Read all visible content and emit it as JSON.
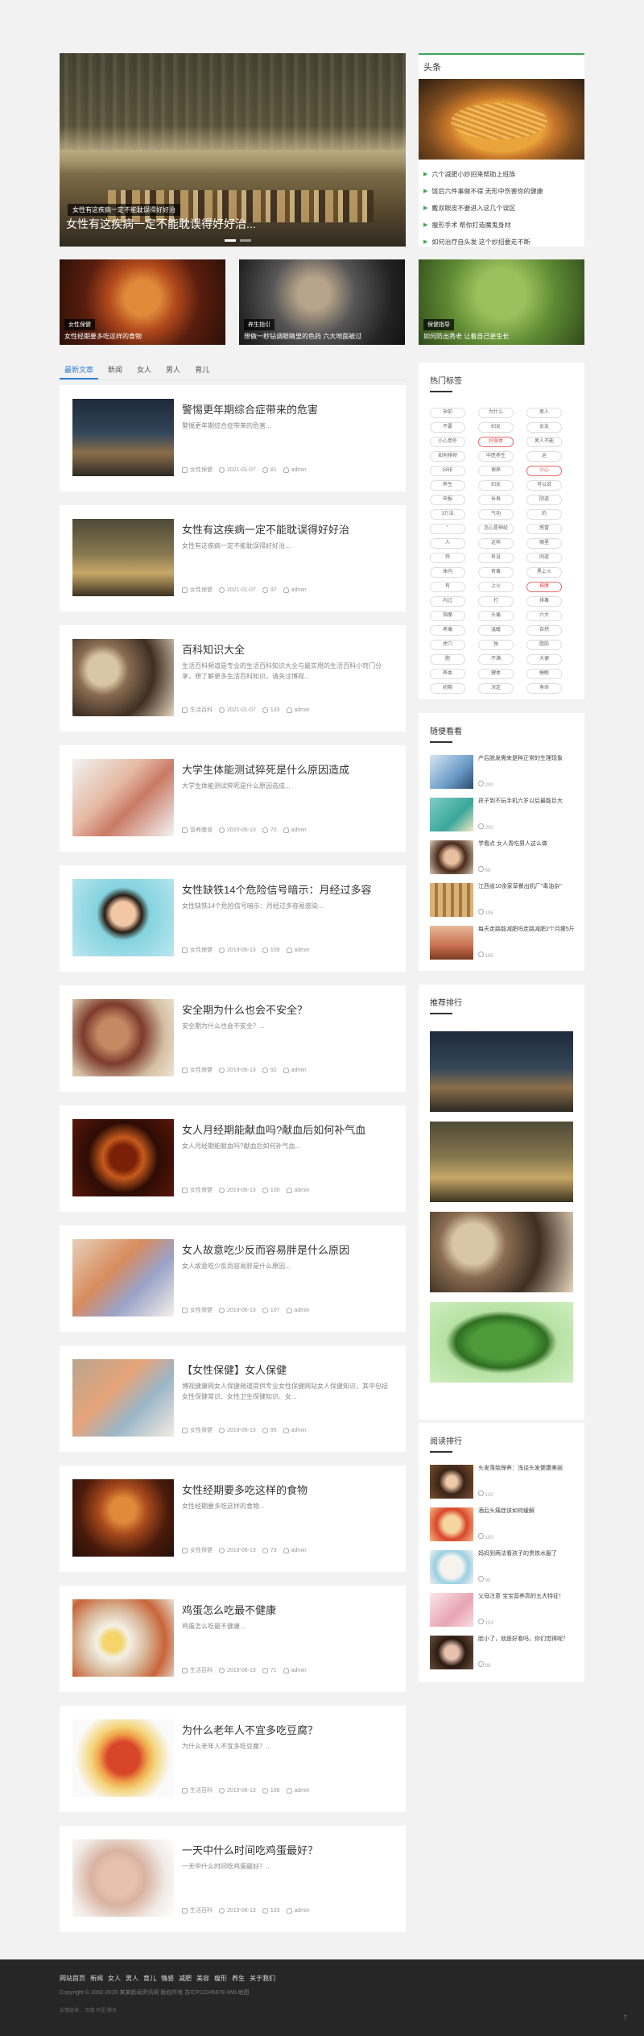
{
  "hero": {
    "tag": "女性有这疾病一定不能耽误得好好治",
    "caption": "女性有这疾病一定不能耽误得好好治..."
  },
  "headline": {
    "title": "头条",
    "items": [
      "六个减肥小妙招来帮助上班族",
      "饭后六件事做不得 无形中伤害你的健康",
      "戴双眼皮不要进入这几个误区",
      "瘦形手术 帮你打造魔鬼身材",
      "如何治疗自头发 这个妙招要走不断"
    ]
  },
  "small_cards": [
    {
      "tag": "女性保健",
      "caption": "女性经期要多吃这样的食物"
    },
    {
      "tag": "养生指引",
      "caption": "想做一秒钻调眼睛里的色药 六大地面被过"
    },
    {
      "tag": "保健指导",
      "caption": "如何防出秀老 让着自己更生长"
    }
  ],
  "tabs": [
    "最新文章",
    "新闻",
    "女人",
    "男人",
    "育儿"
  ],
  "articles": [
    {
      "title": "警惕更年期综合症带来的危害",
      "desc": "警惕更年期综合症带来的危害...",
      "cat": "女性保健",
      "date": "2021-01-07",
      "views": "81",
      "author": "admin"
    },
    {
      "title": "女性有这疾病一定不能耽误得好好治",
      "desc": "女性有这疾病一定不能耽误得好好治...",
      "cat": "女性保健",
      "date": "2021-01-07",
      "views": "97",
      "author": "admin"
    },
    {
      "title": "百科知识大全",
      "desc": "生活百科频道是专业的生活百科知识大全与最实用的生活百科小窍门分享，想了解更多生活百科知识，请关注博视...",
      "cat": "生活百科",
      "date": "2021-01-07",
      "views": "133",
      "author": "admin"
    },
    {
      "title": "大学生体能测试猝死是什么原因造成",
      "desc": "大学生体能测试猝死是什么原因造成...",
      "cat": "营养膳食",
      "date": "2020-06-10",
      "views": "70",
      "author": "admin"
    },
    {
      "title": "女性缺铁14个危险信号暗示：月经过多容",
      "desc": "女性缺铁14个危险信号暗示：月经过多容易感染...",
      "cat": "女性保健",
      "date": "2019-06-13",
      "views": "109",
      "author": "admin"
    },
    {
      "title": "安全期为什么也会不安全？",
      "desc": "安全期为什么也会不安全？...",
      "cat": "女性保健",
      "date": "2019-06-13",
      "views": "92",
      "author": "admin"
    },
    {
      "title": "女人月经期能献血吗?献血后如何补气血",
      "desc": "女人月经期能献血吗?献血后如何补气血...",
      "cat": "女性保健",
      "date": "2019-06-13",
      "views": "100",
      "author": "admin"
    },
    {
      "title": "女人故意吃少反而容易胖是什么原因",
      "desc": "女人故意吃少反而容易胖是什么原因...",
      "cat": "女性保健",
      "date": "2019-06-13",
      "views": "107",
      "author": "admin"
    },
    {
      "title": "【女性保健】女人保健",
      "desc": "博视健康网女人保健频道提供专业女性保健网站女人保健知识，其中包括女性保健常识、女性卫生保健知识、女...",
      "cat": "女性保健",
      "date": "2019-06-13",
      "views": "95",
      "author": "admin"
    },
    {
      "title": "女性经期要多吃这样的食物",
      "desc": "女性经期要多吃这样的食物...",
      "cat": "女性保健",
      "date": "2019-06-13",
      "views": "73",
      "author": "admin"
    },
    {
      "title": "鸡蛋怎么吃最不健康",
      "desc": "鸡蛋怎么吃最不健康...",
      "cat": "生活百科",
      "date": "2019-06-13",
      "views": "71",
      "author": "admin"
    },
    {
      "title": "为什么老年人不宜多吃豆腐？",
      "desc": "为什么老年人不宜多吃豆腐？...",
      "cat": "生活百科",
      "date": "2019-06-13",
      "views": "106",
      "author": "admin"
    },
    {
      "title": "一天中什么时间吃鸡蛋最好？",
      "desc": "一天中什么时间吃鸡蛋最好？...",
      "cat": "生活百科",
      "date": "2019-06-13",
      "views": "103",
      "author": "admin"
    }
  ],
  "hot_tags": {
    "title": "热门标签",
    "items": [
      "孕前",
      "为什么",
      "男人",
      "不要",
      "妇女",
      "女友",
      "小心意外",
      "好身体",
      "男人不能",
      "如何排卵",
      "中医养生",
      "运",
      "GRE",
      "保养",
      "小心",
      "养生",
      "妇女",
      "可以说",
      "申报",
      "长寿",
      "阴道",
      "3方法",
      "气功",
      "的",
      "\"",
      "怎心是神经",
      "感冒",
      "人",
      "这样",
      "哪里",
      "鸡",
      "有没",
      "同道",
      "体内",
      "有毒",
      "黑上火",
      "有",
      "上火",
      "按摩",
      "内过",
      "打",
      "排毒",
      "指摩",
      "头痛",
      "六大",
      "疼痛",
      "温暖",
      "自然",
      "虎穴",
      "独",
      "脂肪",
      "胞",
      "不满",
      "大便",
      "养血",
      "健体",
      "睡眠",
      "初期",
      "决定",
      "寿命"
    ]
  },
  "random": {
    "title": "随便看看",
    "items": [
      {
        "title": "产后脱发需来是种正常的生理现象",
        "views": "200"
      },
      {
        "title": "孩子到不玩手机六岁以后最能巨大",
        "views": "200"
      },
      {
        "title": "学看点 女人青吃男人这么做",
        "views": "68"
      },
      {
        "title": "江西省10余家草餐出机厂\"毒油杂\"",
        "views": "195"
      },
      {
        "title": "每天走路能减肥吗走路减肥2个月瘦5斤",
        "views": "195"
      }
    ]
  },
  "recommend": {
    "title": "推荐排行"
  },
  "reading": {
    "title": "阅读排行",
    "items": [
      {
        "title": "头发落始保养：浅谈头发健康美丽",
        "views": "132"
      },
      {
        "title": "酒后头痛症该如何缓解",
        "views": "193"
      },
      {
        "title": "妈妈到两法看孩子的贵铁水服了",
        "views": "90"
      },
      {
        "title": "父母注意 宝宝营养高的五大特征！",
        "views": "153"
      },
      {
        "title": "脸小了，就是好看吗，你们觉得呢？",
        "views": "88"
      }
    ]
  },
  "footer": {
    "links": [
      "网站首页",
      "新闻",
      "女人",
      "男人",
      "育儿",
      "情感",
      "减肥",
      "美容",
      "瘦形",
      "养生",
      "关于我们"
    ],
    "copyright": "Copyright © 2002-2020 某某新闻资讯网 版权所有 苏ICP12345678 XML地图",
    "friend": "友情链接：  百度  阿里  腾讯",
    "top_label": "↑"
  }
}
